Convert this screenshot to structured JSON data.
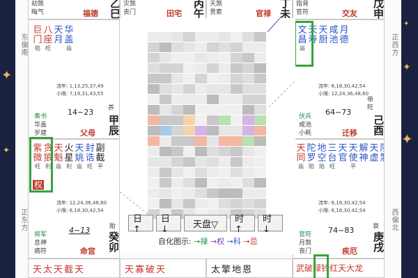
{
  "colors": {
    "frame": "#1b2140",
    "accent_red": "#c0392b",
    "highlight_green": "#35a23e",
    "star_gold": "#e6b85c"
  },
  "sides": {
    "left_top": "东偏南",
    "left_bottom": "正东方",
    "right_top": "正西方",
    "right_bottom": "西偏北"
  },
  "top_left": {
    "l1": "劫煞",
    "l2": "晦气",
    "palace": "福德",
    "ganzhi": "乙巳"
  },
  "top_mid1": {
    "l1": "灾煞",
    "l2": "丧门",
    "palace": "田宅",
    "ganzhi": "丙午"
  },
  "top_mid2": {
    "l1": "天煞",
    "l2": "贯索",
    "palace": "官禄",
    "ganzhi": "丁未"
  },
  "top_right": {
    "l1": "指背",
    "l2": "官符",
    "palace": "交友",
    "ganzhi": "戊申"
  },
  "left_upper": {
    "stars": [
      {
        "big": "巨",
        "big2": "门",
        "sm": "陷"
      },
      {
        "big": "八",
        "big2": "座",
        "sm": "旺"
      },
      {
        "big": "天",
        "big2": "月",
        "sm": ""
      },
      {
        "big": "华",
        "big2": "盖",
        "sm": "庙"
      }
    ],
    "flow1": "流年: 1,13,25,37,49",
    "flow2": "小限: 7,19,31,43,55",
    "range": "14~23",
    "god1": "奏书",
    "god2": "华盖",
    "god3": "岁建",
    "chang": "养",
    "palace": "父母",
    "ganzhi": "甲辰"
  },
  "right_upper": {
    "stars": [
      {
        "big": "文",
        "big2": "昌",
        "sm": "庙"
      },
      {
        "big": "天",
        "big2": "寿",
        "sm": ""
      },
      {
        "big": "天",
        "big2": "厨",
        "sm": ""
      },
      {
        "big": "咸",
        "big2": "池",
        "sm": ""
      },
      {
        "big": "月",
        "big2": "德",
        "sm": ""
      }
    ],
    "flow1": "流年: 6,18,30,42,54",
    "flow2": "小限: 12,24,36,48,60",
    "range": "64~73",
    "god1": "伏兵",
    "god2": "咸池",
    "god3": "小耗",
    "chang": "帝旺",
    "palace": "迁移",
    "ganzhi": "己酉"
  },
  "left_lower": {
    "stars": [
      {
        "big": "紫",
        "big2": "微",
        "sm": "旺"
      },
      {
        "big": "贪",
        "big2": "狼",
        "sm": "利"
      },
      {
        "big": "天",
        "big2": "魁",
        "sm": "庙"
      },
      {
        "big": "火",
        "big2": "星",
        "sm": "利"
      },
      {
        "big": "天",
        "big2": "姚",
        "sm": "庙"
      },
      {
        "big": "封",
        "big2": "诰",
        "sm": "旺"
      },
      {
        "big": "副",
        "big2": "截",
        "sm": "平"
      }
    ],
    "hua": "权",
    "flow1": "流年: 12,24,36,48,60",
    "flow2": "小限: 6,18,30,42,54",
    "range": "4~13",
    "god1": "将军",
    "god2": "息神",
    "god3": "病符",
    "chang": "胎",
    "palace": "命宫",
    "ganzhi": "癸卯"
  },
  "right_lower": {
    "stars": [
      {
        "big": "天",
        "big2": "同",
        "sm": "庙"
      },
      {
        "big": "陀",
        "big2": "罗",
        "sm": "陷"
      },
      {
        "big": "地",
        "big2": "空",
        "sm": "陷"
      },
      {
        "big": "三",
        "big2": "台",
        "sm": "旺"
      },
      {
        "big": "天",
        "big2": "官",
        "sm": ""
      },
      {
        "big": "天",
        "big2": "使",
        "sm": "平"
      },
      {
        "big": "解",
        "big2": "神",
        "sm": ""
      },
      {
        "big": "天",
        "big2": "虚",
        "sm": ""
      },
      {
        "big": "阴",
        "big2": "煞",
        "sm": ""
      }
    ],
    "flow1": "流年: 6,18,30,42,54",
    "flow2": "小限: 6,18,30,42,54",
    "range": "74~83",
    "god1": "官符",
    "god2": "月煞",
    "god3": "丧门",
    "chang": "衰",
    "palace": "疾厄",
    "ganzhi": "庚戌"
  },
  "toolbar": {
    "btn1": "日↑",
    "btn2": "日↓",
    "btn3": "天盘▽",
    "btn4": "时↑",
    "btn5": "时↓"
  },
  "legend": {
    "prefix": "自化图示:",
    "lu": "→禄",
    "quan": "→权",
    "ke": "→科",
    "ji": "→忌"
  },
  "bottom": {
    "c1": "天太天截天",
    "c2": "天寡破天",
    "c3": "太擎地恩",
    "c4": "武破禄铃红天大龙"
  }
}
